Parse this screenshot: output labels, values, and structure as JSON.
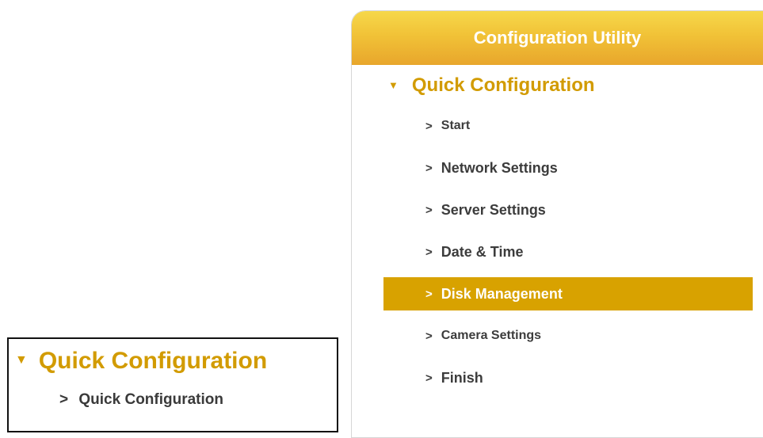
{
  "left_panel": {
    "header": {
      "triangle_icon": "triangle-down-icon",
      "label": "Quick Configuration"
    },
    "item": {
      "chevron": ">",
      "label": "Quick Configuration"
    }
  },
  "right_panel": {
    "title": "Configuration Utility",
    "section": {
      "triangle_icon": "triangle-down-icon",
      "label": "Quick Configuration"
    },
    "chevron": ">",
    "items": [
      {
        "label": "Start",
        "active": false
      },
      {
        "label": "Network Settings",
        "active": false
      },
      {
        "label": "Server Settings",
        "active": false
      },
      {
        "label": "Date & Time",
        "active": false
      },
      {
        "label": "Disk Management",
        "active": true
      },
      {
        "label": "Camera Settings",
        "active": false
      },
      {
        "label": "Finish",
        "active": false
      }
    ]
  },
  "colors": {
    "accent_text": "#d29b00",
    "active_bg": "#d8a200",
    "title_gradient_top": "#f6d84a",
    "title_gradient_bottom": "#e8a62c"
  }
}
